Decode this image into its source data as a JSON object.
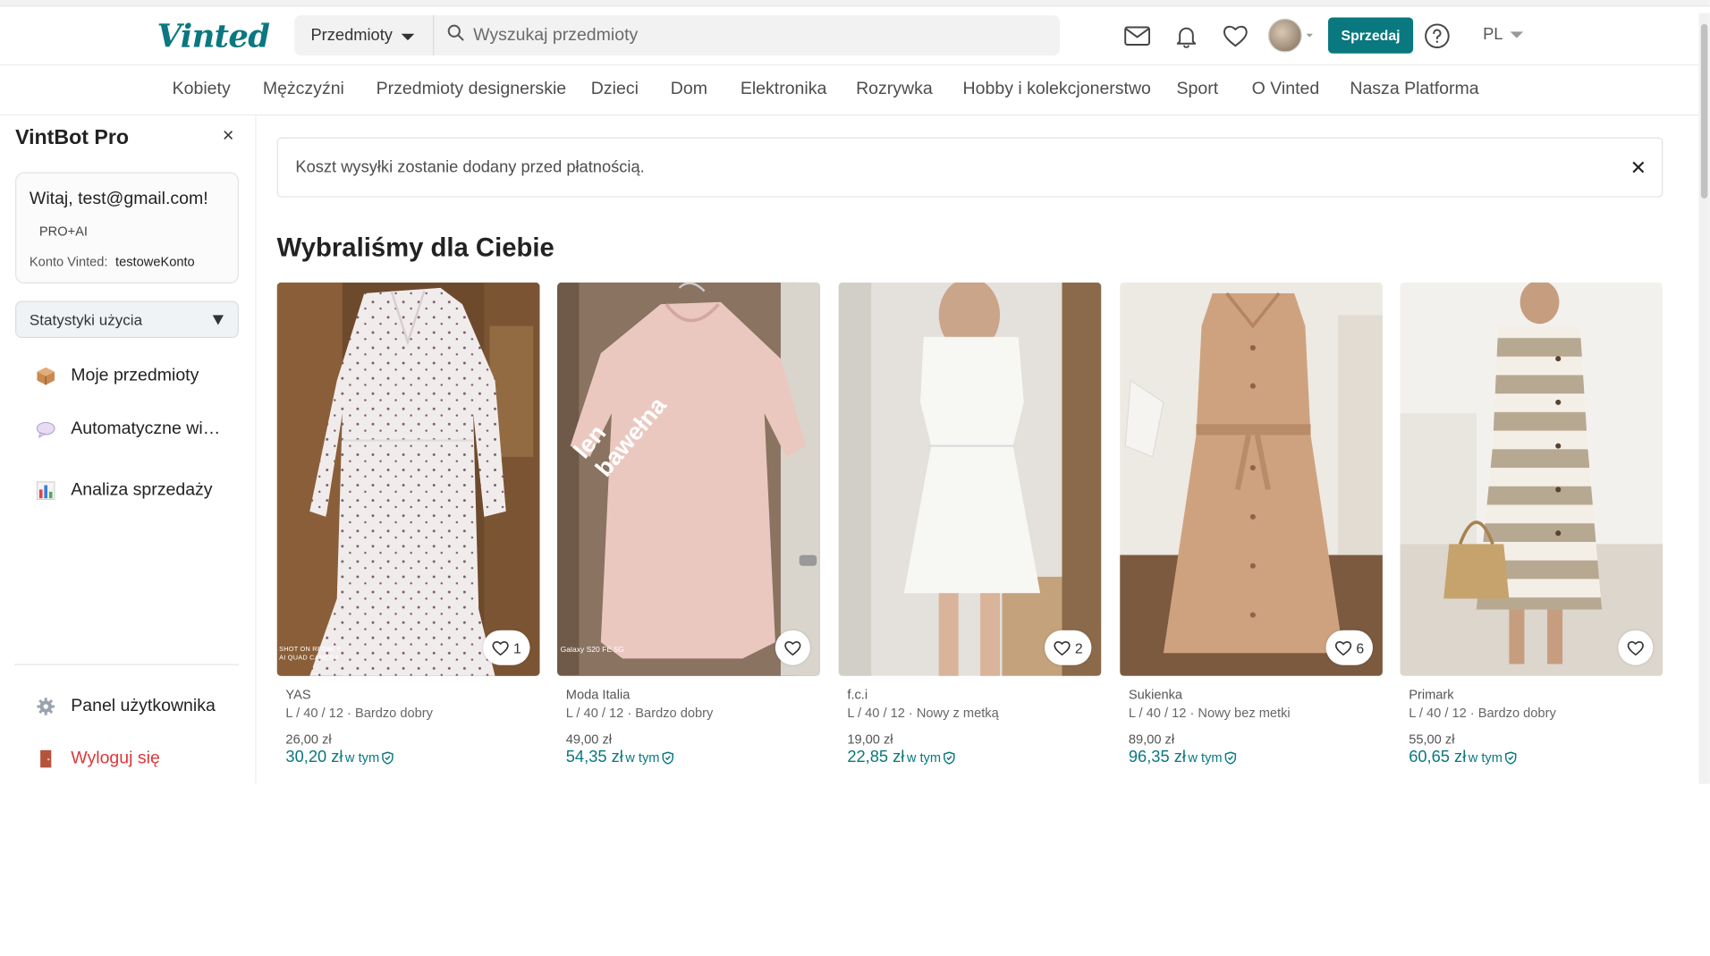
{
  "header": {
    "logo": "Vinted",
    "search_category": "Przedmioty",
    "search_placeholder": "Wyszukaj przedmioty",
    "sell_label": "Sprzedaj",
    "language": "PL",
    "accent_color": "#09787f"
  },
  "nav": {
    "items": [
      "Kobiety",
      "Mężczyźni",
      "Przedmioty designerskie",
      "Dzieci",
      "Dom",
      "Elektronika",
      "Rozrywka",
      "Hobby i kolekcjonerstwo",
      "Sport",
      "O Vinted",
      "Nasza Platforma"
    ]
  },
  "sidebar": {
    "title": "VintBot Pro",
    "close": "×",
    "greeting": "Witaj, test@gmail.com!",
    "plan": "PRO+AI",
    "account_label": "Konto Vinted:",
    "account_name": "testoweKonto",
    "stats_select": "Statystyki użycia",
    "items": [
      {
        "label": "Moje przedmioty",
        "icon": "package-icon"
      },
      {
        "label": "Automatyczne wi…",
        "icon": "speech-bubble-icon"
      },
      {
        "label": "Analiza sprzedaży",
        "icon": "bar-chart-icon"
      }
    ],
    "panel_label": "Panel użytkownika",
    "logout_label": "Wyloguj się"
  },
  "main": {
    "notice": "Koszt wysyłki zostanie dodany przed płatnością.",
    "section_title": "Wybraliśmy dla Ciebie",
    "items": [
      {
        "brand": "YAS",
        "meta": "L / 40 / 12 · Bardzo dobry",
        "price": "26,00 zł",
        "total": "30,20 zł",
        "total_note": "w tym",
        "favorites": "1",
        "photo_caption": "SHOT ON REDMI 9",
        "photo_caption2": "AI QUAD CAMERA"
      },
      {
        "brand": "Moda Italia",
        "meta": "L / 40 / 12 · Bardzo dobry",
        "price": "49,00 zł",
        "total": "54,35 zł",
        "total_note": "w tym",
        "favorites": "",
        "photo_caption": "Galaxy S20 FE 5G",
        "overlay_line1": "len",
        "overlay_line2": "bawełna"
      },
      {
        "brand": "f.c.i",
        "meta": "L / 40 / 12 · Nowy z metką",
        "price": "19,00 zł",
        "total": "22,85 zł",
        "total_note": "w tym",
        "favorites": "2"
      },
      {
        "brand": "Sukienka",
        "meta": "L / 40 / 12 · Nowy bez metki",
        "price": "89,00 zł",
        "total": "96,35 zł",
        "total_note": "w tym",
        "favorites": "6"
      },
      {
        "brand": "Primark",
        "meta": "L / 40 / 12 · Bardzo dobry",
        "price": "55,00 zł",
        "total": "60,65 zł",
        "total_note": "w tym",
        "favorites": ""
      }
    ]
  }
}
